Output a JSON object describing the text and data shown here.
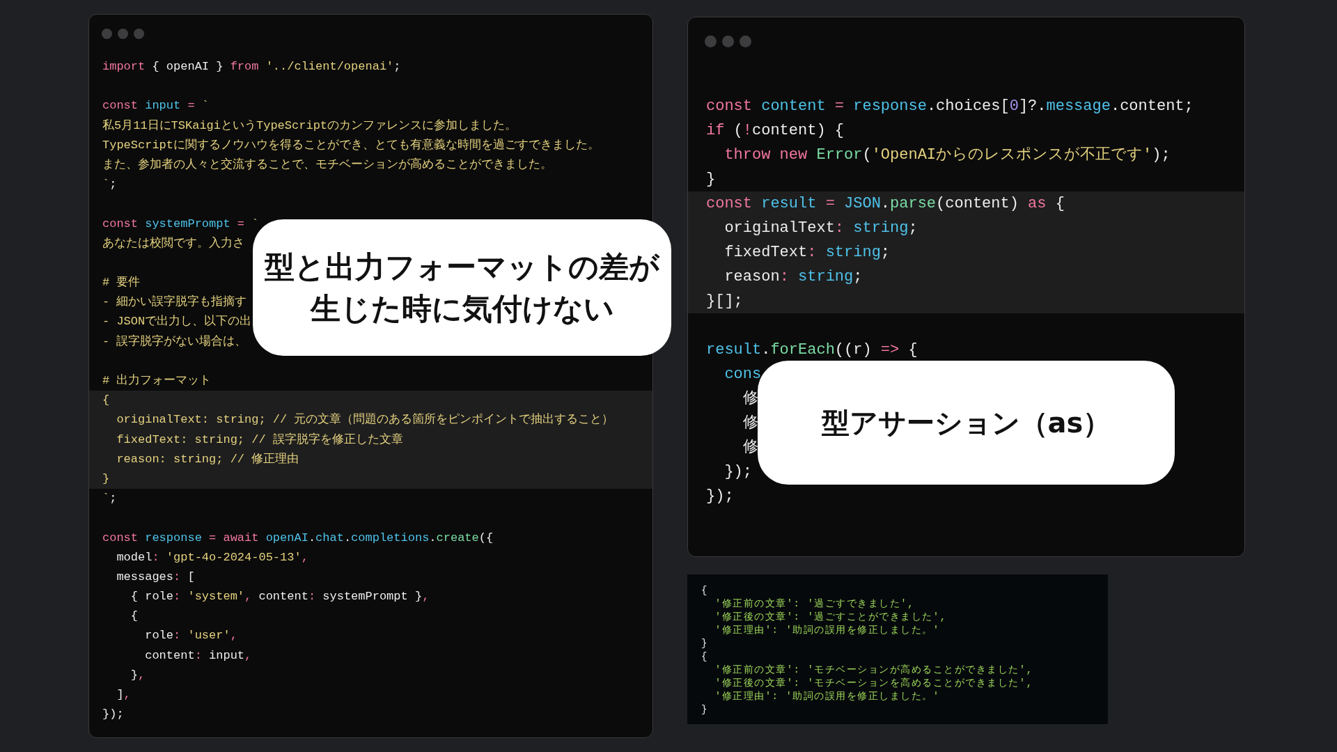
{
  "code_window": {
    "blocks": [
      {
        "lines": [
          {
            "tokens": [
              {
                "kind": "kw",
                "text": "import"
              },
              {
                "kind": "plain",
                "text": " { openAI } "
              },
              {
                "kind": "kw",
                "text": "from"
              },
              {
                "kind": "str",
                "text": " '../client/openai'"
              },
              {
                "kind": "plain",
                "text": ";"
              }
            ]
          },
          {
            "blank_before": true,
            "tokens": [
              {
                "kind": "kw",
                "text": "const"
              },
              {
                "kind": "var",
                "text": " input"
              },
              {
                "kind": "kw",
                "text": " ="
              },
              {
                "kind": "str",
                "text": " `"
              }
            ]
          },
          {
            "tokens": [
              {
                "kind": "str",
                "text": "私5月11日にTSKaigiというTypeScriptのカンファレンスに参加しました。"
              }
            ]
          },
          {
            "tokens": [
              {
                "kind": "str",
                "text": "TypeScriptに関するノウハウを得ることができ、とても有意義な時間を過ごすできました。"
              }
            ]
          },
          {
            "tokens": [
              {
                "kind": "str",
                "text": "また、参加者の人々と交流することで、モチベーションが高めることができました。"
              }
            ]
          },
          {
            "tokens": [
              {
                "kind": "str",
                "text": "`"
              },
              {
                "kind": "plain",
                "text": ";"
              }
            ]
          },
          {
            "blank_before": true,
            "tokens": [
              {
                "kind": "kw",
                "text": "const"
              },
              {
                "kind": "var",
                "text": " systemPrompt"
              },
              {
                "kind": "kw",
                "text": " ="
              },
              {
                "kind": "str",
                "text": " `"
              }
            ]
          },
          {
            "tokens": [
              {
                "kind": "str",
                "text": "あなたは校閲です。入力さ"
              }
            ]
          },
          {
            "blank_before": true,
            "tokens": [
              {
                "kind": "str",
                "text": "# 要件"
              }
            ]
          },
          {
            "tokens": [
              {
                "kind": "str",
                "text": "- 細かい誤字脱字も指摘す"
              }
            ]
          },
          {
            "tokens": [
              {
                "kind": "str",
                "text": "- JSONで出力し、以下の出"
              }
            ]
          },
          {
            "tokens": [
              {
                "kind": "str",
                "text": "- 誤字脱字がない場合は、"
              }
            ]
          },
          {
            "blank_before": true,
            "tokens": [
              {
                "kind": "str",
                "text": "# 出力フォーマット"
              }
            ]
          }
        ]
      },
      {
        "highlighted": true,
        "lines": [
          {
            "tokens": [
              {
                "kind": "str",
                "text": "{"
              }
            ]
          },
          {
            "tokens": [
              {
                "kind": "str",
                "text": "  originalText: string; // 元の文章（問題のある箇所をピンポイントで抽出すること）"
              }
            ]
          },
          {
            "tokens": [
              {
                "kind": "str",
                "text": "  fixedText: string; // 誤字脱字を修正した文章"
              }
            ]
          },
          {
            "tokens": [
              {
                "kind": "str",
                "text": "  reason: string; // 修正理由"
              }
            ]
          },
          {
            "tokens": [
              {
                "kind": "str",
                "text": "}"
              }
            ]
          }
        ]
      },
      {
        "lines": [
          {
            "tokens": [
              {
                "kind": "str",
                "text": "`"
              },
              {
                "kind": "plain",
                "text": ";"
              }
            ]
          },
          {
            "blank_before": true,
            "tokens": [
              {
                "kind": "kw",
                "text": "const"
              },
              {
                "kind": "var",
                "text": " response"
              },
              {
                "kind": "kw",
                "text": " ="
              },
              {
                "kind": "kw",
                "text": " await"
              },
              {
                "kind": "var",
                "text": " openAI"
              },
              {
                "kind": "plain",
                "text": "."
              },
              {
                "kind": "var",
                "text": "chat"
              },
              {
                "kind": "plain",
                "text": "."
              },
              {
                "kind": "var",
                "text": "completions"
              },
              {
                "kind": "plain",
                "text": "."
              },
              {
                "kind": "fn",
                "text": "create"
              },
              {
                "kind": "plain",
                "text": "({"
              }
            ]
          },
          {
            "tokens": [
              {
                "kind": "plain",
                "text": "  model"
              },
              {
                "kind": "pun",
                "text": ":"
              },
              {
                "kind": "str",
                "text": " 'gpt-4o-2024-05-13'"
              },
              {
                "kind": "pun",
                "text": ","
              }
            ]
          },
          {
            "tokens": [
              {
                "kind": "plain",
                "text": "  messages"
              },
              {
                "kind": "pun",
                "text": ":"
              },
              {
                "kind": "plain",
                "text": " ["
              }
            ]
          },
          {
            "tokens": [
              {
                "kind": "plain",
                "text": "    { role"
              },
              {
                "kind": "pun",
                "text": ":"
              },
              {
                "kind": "str",
                "text": " 'system'"
              },
              {
                "kind": "pun",
                "text": ","
              },
              {
                "kind": "plain",
                "text": " content"
              },
              {
                "kind": "pun",
                "text": ":"
              },
              {
                "kind": "plain",
                "text": " systemPrompt }"
              },
              {
                "kind": "pun",
                "text": ","
              }
            ]
          },
          {
            "tokens": [
              {
                "kind": "plain",
                "text": "    {"
              }
            ]
          },
          {
            "tokens": [
              {
                "kind": "plain",
                "text": "      role"
              },
              {
                "kind": "pun",
                "text": ":"
              },
              {
                "kind": "str",
                "text": " 'user'"
              },
              {
                "kind": "pun",
                "text": ","
              }
            ]
          },
          {
            "tokens": [
              {
                "kind": "plain",
                "text": "      content"
              },
              {
                "kind": "pun",
                "text": ":"
              },
              {
                "kind": "plain",
                "text": " input"
              },
              {
                "kind": "pun",
                "text": ","
              }
            ]
          },
          {
            "tokens": [
              {
                "kind": "plain",
                "text": "    }"
              },
              {
                "kind": "pun",
                "text": ","
              }
            ]
          },
          {
            "tokens": [
              {
                "kind": "plain",
                "text": "  ]"
              },
              {
                "kind": "pun",
                "text": ","
              }
            ]
          },
          {
            "tokens": [
              {
                "kind": "plain",
                "text": "});"
              }
            ]
          }
        ]
      }
    ]
  },
  "callouts": [
    {
      "lines": [
        "型と出力フォーマットの差が",
        "生じた時に気付けない"
      ]
    },
    {
      "lines": [
        "型アサーション（as）"
      ]
    }
  ],
  "assertion_window": {
    "blocks": [
      {
        "lines": [
          {
            "tokens": [
              {
                "kind": "kw",
                "text": "const"
              },
              {
                "kind": "var",
                "text": " content"
              },
              {
                "kind": "kw",
                "text": " ="
              },
              {
                "kind": "var",
                "text": " response"
              },
              {
                "kind": "plain",
                "text": ".choices["
              },
              {
                "kind": "num",
                "text": "0"
              },
              {
                "kind": "plain",
                "text": "]?."
              },
              {
                "kind": "var",
                "text": "message"
              },
              {
                "kind": "plain",
                "text": ".content;"
              }
            ]
          },
          {
            "tokens": [
              {
                "kind": "kw",
                "text": "if"
              },
              {
                "kind": "plain",
                "text": " ("
              },
              {
                "kind": "kw",
                "text": "!"
              },
              {
                "kind": "plain",
                "text": "content) {"
              }
            ]
          },
          {
            "tokens": [
              {
                "kind": "kw",
                "text": "  throw"
              },
              {
                "kind": "kw",
                "text": " new"
              },
              {
                "kind": "fn",
                "text": " Error"
              },
              {
                "kind": "plain",
                "text": "("
              },
              {
                "kind": "str",
                "text": "'OpenAIからのレスポンスが不正です'"
              },
              {
                "kind": "plain",
                "text": ");"
              }
            ]
          },
          {
            "tokens": [
              {
                "kind": "plain",
                "text": "}"
              }
            ]
          }
        ]
      },
      {
        "highlighted": true,
        "lines": [
          {
            "tokens": [
              {
                "kind": "kw",
                "text": "const"
              },
              {
                "kind": "var",
                "text": " result"
              },
              {
                "kind": "kw",
                "text": " ="
              },
              {
                "kind": "var",
                "text": " JSON"
              },
              {
                "kind": "plain",
                "text": "."
              },
              {
                "kind": "fn",
                "text": "parse"
              },
              {
                "kind": "plain",
                "text": "(content) "
              },
              {
                "kind": "kw",
                "text": "as"
              },
              {
                "kind": "plain",
                "text": " {"
              }
            ]
          },
          {
            "tokens": [
              {
                "kind": "plain",
                "text": "  originalText"
              },
              {
                "kind": "pun",
                "text": ":"
              },
              {
                "kind": "var",
                "text": " string"
              },
              {
                "kind": "plain",
                "text": ";"
              }
            ]
          },
          {
            "tokens": [
              {
                "kind": "plain",
                "text": "  fixedText"
              },
              {
                "kind": "pun",
                "text": ":"
              },
              {
                "kind": "var",
                "text": " string"
              },
              {
                "kind": "plain",
                "text": ";"
              }
            ]
          },
          {
            "tokens": [
              {
                "kind": "plain",
                "text": "  reason"
              },
              {
                "kind": "pun",
                "text": ":"
              },
              {
                "kind": "var",
                "text": " string"
              },
              {
                "kind": "plain",
                "text": ";"
              }
            ]
          },
          {
            "tokens": [
              {
                "kind": "plain",
                "text": "}[];"
              }
            ]
          }
        ]
      },
      {
        "lines": [
          {
            "blank_before": true,
            "tokens": [
              {
                "kind": "var",
                "text": "result"
              },
              {
                "kind": "plain",
                "text": "."
              },
              {
                "kind": "fn",
                "text": "forEach"
              },
              {
                "kind": "plain",
                "text": "((r) "
              },
              {
                "kind": "kw",
                "text": "=>"
              },
              {
                "kind": "plain",
                "text": " {"
              }
            ]
          },
          {
            "tokens": [
              {
                "kind": "var",
                "text": "  cons"
              }
            ]
          },
          {
            "tokens": [
              {
                "kind": "plain",
                "text": "    修"
              }
            ]
          },
          {
            "tokens": [
              {
                "kind": "plain",
                "text": "    修"
              }
            ]
          },
          {
            "tokens": [
              {
                "kind": "plain",
                "text": "    修"
              }
            ]
          },
          {
            "tokens": [
              {
                "kind": "plain",
                "text": "  });"
              }
            ]
          },
          {
            "tokens": [
              {
                "kind": "plain",
                "text": "});"
              }
            ]
          }
        ]
      }
    ]
  },
  "output_panel": {
    "lines": [
      {
        "tokens": [
          {
            "kind": "plain",
            "text": "{"
          }
        ]
      },
      {
        "tokens": [
          {
            "kind": "out",
            "text": "  '修正前の文章': '過ごすできました',"
          }
        ]
      },
      {
        "tokens": [
          {
            "kind": "out",
            "text": "  '修正後の文章': '過ごすことができました',"
          }
        ]
      },
      {
        "tokens": [
          {
            "kind": "out",
            "text": "  '修正理由': '助詞の誤用を修正しました。'"
          }
        ]
      },
      {
        "tokens": [
          {
            "kind": "plain",
            "text": "}"
          }
        ]
      },
      {
        "tokens": [
          {
            "kind": "plain",
            "text": "{"
          }
        ]
      },
      {
        "tokens": [
          {
            "kind": "out",
            "text": "  '修正前の文章': 'モチベーションが高めることができました',"
          }
        ]
      },
      {
        "tokens": [
          {
            "kind": "out",
            "text": "  '修正後の文章': 'モチベーションを高めることができました',"
          }
        ]
      },
      {
        "tokens": [
          {
            "kind": "out",
            "text": "  '修正理由': '助詞の誤用を修正しました。'"
          }
        ]
      },
      {
        "tokens": [
          {
            "kind": "plain",
            "text": "}"
          }
        ]
      }
    ]
  }
}
